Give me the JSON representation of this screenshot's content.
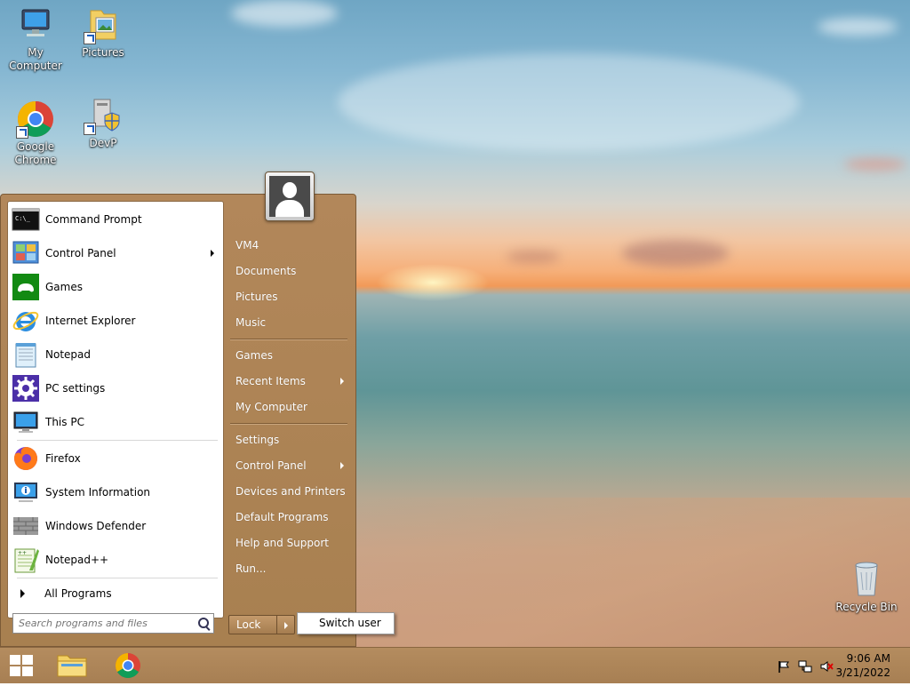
{
  "desktop": {
    "icons": [
      {
        "label": "My Computer"
      },
      {
        "label": "Pictures"
      },
      {
        "label": "Google Chrome"
      },
      {
        "label": "DevP"
      },
      {
        "label": "Recycle Bin"
      }
    ]
  },
  "start_menu": {
    "pinned_programs": [
      {
        "label": "Command Prompt",
        "icon": "command-prompt-icon"
      },
      {
        "label": "Control Panel",
        "icon": "control-panel-icon",
        "has_submenu": true
      },
      {
        "label": "Games",
        "icon": "games-icon"
      },
      {
        "label": "Internet Explorer",
        "icon": "internet-explorer-icon"
      },
      {
        "label": "Notepad",
        "icon": "notepad-icon"
      },
      {
        "label": "PC settings",
        "icon": "gear-icon"
      },
      {
        "label": "This PC",
        "icon": "computer-icon"
      }
    ],
    "recent_programs": [
      {
        "label": "Firefox",
        "icon": "firefox-icon"
      },
      {
        "label": "System Information",
        "icon": "system-information-icon"
      },
      {
        "label": "Windows Defender",
        "icon": "windows-defender-icon"
      },
      {
        "label": "Notepad++",
        "icon": "notepad-plus-plus-icon"
      }
    ],
    "all_programs_label": "All Programs",
    "search_placeholder": "Search programs and files",
    "right_links": [
      {
        "label": "VM4"
      },
      {
        "label": "Documents"
      },
      {
        "label": "Pictures"
      },
      {
        "label": "Music"
      },
      {
        "label": "Games"
      },
      {
        "label": "Recent Items",
        "has_submenu": true
      },
      {
        "label": "My Computer"
      },
      {
        "label": "Settings"
      },
      {
        "label": "Control Panel",
        "has_submenu": true
      },
      {
        "label": "Devices and Printers"
      },
      {
        "label": "Default Programs"
      },
      {
        "label": "Help and Support"
      },
      {
        "label": "Run..."
      }
    ],
    "lock_label": "Lock",
    "switch_user_label": "Switch user"
  },
  "taskbar": {
    "time": "9:06 AM",
    "date": "3/21/2022",
    "pinned": [
      "start-button",
      "file-explorer-icon",
      "chrome-icon"
    ],
    "tray": [
      "action-center-flag-icon",
      "network-icon",
      "volume-muted-icon"
    ]
  }
}
